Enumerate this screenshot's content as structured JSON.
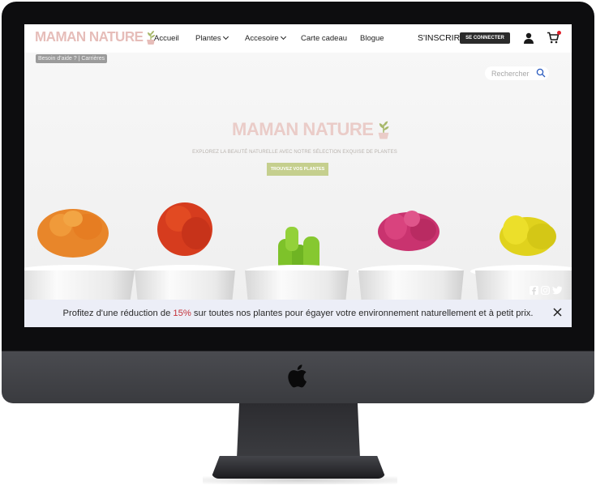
{
  "brand": {
    "name": "MAMAN NATURE"
  },
  "nav": {
    "items": [
      {
        "label": "Accueil",
        "dropdown": false
      },
      {
        "label": "Plantes",
        "dropdown": true
      },
      {
        "label": "Accesoire",
        "dropdown": true
      },
      {
        "label": "Carte cadeau",
        "dropdown": false
      },
      {
        "label": "Blogue",
        "dropdown": false
      }
    ],
    "signup_label": "S'INSCRIRE",
    "login_label": "SE CONNECTER"
  },
  "utility": {
    "help_links": "Besoin d'aide ? | Carrières"
  },
  "search": {
    "placeholder": "Rechercher"
  },
  "hero": {
    "title": "MAMAN NATURE",
    "subtitle": "EXPLOREZ LA BEAUTÉ NATURELLE AVEC NOTRE SÉLECTION EXQUISE DE PLANTES",
    "cta_label": "TROUVEZ VOS PLANTES"
  },
  "promo": {
    "text_before": "Profitez d'une réduction de ",
    "highlight": "15%",
    "text_after": " sur toutes nos plantes pour égayer votre environnement naturellement et à petit prix."
  },
  "icons": {
    "user": "user-icon",
    "cart": "cart-icon",
    "search": "search-icon",
    "close": "close-icon",
    "social": [
      "facebook-icon",
      "instagram-icon",
      "twitter-icon"
    ]
  },
  "colors": {
    "brand_pink": "#e6bdb9",
    "cta_green": "#c5cf8e",
    "login_button": "#2b2b2b",
    "promo_highlight": "#c4333a",
    "promo_background": "#eceef7",
    "cart_badge": "#e01f2a"
  }
}
